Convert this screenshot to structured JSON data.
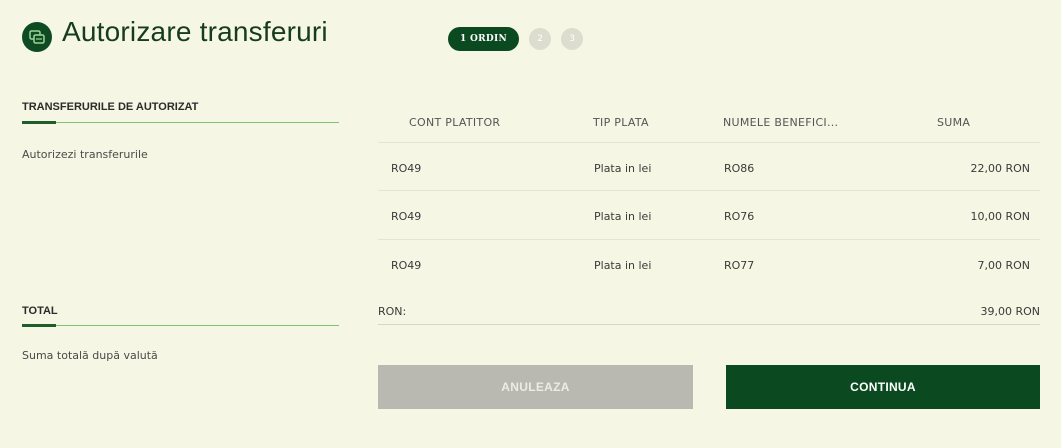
{
  "header": {
    "title": "Autorizare transferuri",
    "icon": "transfer-icon",
    "steps": {
      "active": "1 ORDIN",
      "next": [
        "2",
        "3"
      ]
    }
  },
  "left": {
    "section1": {
      "title": "TRANSFERURILE DE AUTORIZAT",
      "desc": "Autorizezi transferurile"
    },
    "section2": {
      "title": "TOTAL",
      "desc": "Suma totală după valută"
    }
  },
  "table": {
    "headers": [
      "CONT PLATITOR",
      "TIP PLATA",
      "NUMELE BENEFICI...",
      "SUMA"
    ],
    "rows": [
      {
        "account": "RO49",
        "type": "Plata in lei",
        "beneficiary": "RO86",
        "amount": "22,00 RON"
      },
      {
        "account": "RO49",
        "type": "Plata in lei",
        "beneficiary": "RO76",
        "amount": "10,00 RON"
      },
      {
        "account": "RO49",
        "type": "Plata in lei",
        "beneficiary": "RO77",
        "amount": "7,00 RON"
      }
    ],
    "total": {
      "label": "RON:",
      "amount": "39,00 RON"
    }
  },
  "actions": {
    "cancel": "ANULEAZA",
    "continue": "CONTINUA"
  },
  "colors": {
    "primary": "#0b4a20",
    "background": "#f6f6e4",
    "accent_line": "#7cc07a",
    "disabled": "#b9b9b2"
  }
}
